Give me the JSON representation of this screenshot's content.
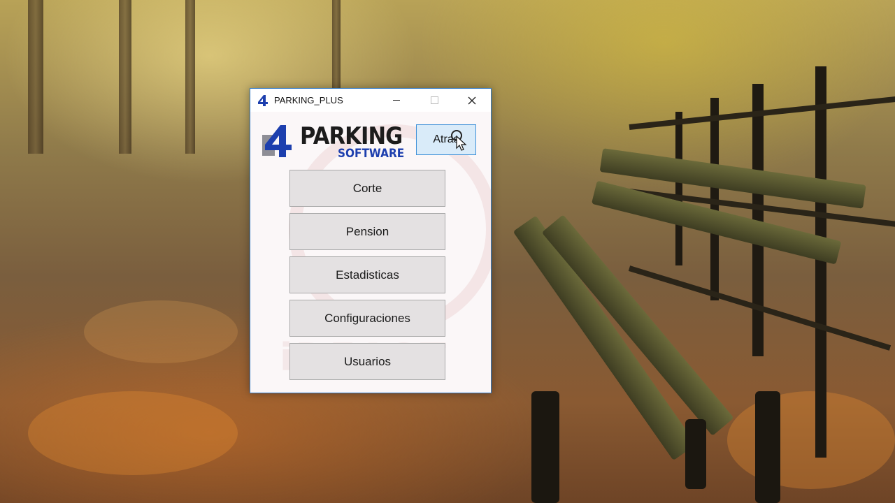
{
  "window": {
    "title": "PARKING_PLUS",
    "accent_color": "#2f78c4"
  },
  "logo": {
    "mark": "4",
    "word_top": "PARKING",
    "word_bottom": "SOFTWARE",
    "brand_color": "#1d3fae"
  },
  "toolbar": {
    "back_label": "Atras"
  },
  "menu": {
    "items": [
      {
        "label": "Corte"
      },
      {
        "label": "Pension"
      },
      {
        "label": "Estadisticas"
      },
      {
        "label": "Configuraciones"
      },
      {
        "label": "Usuarios"
      }
    ]
  },
  "icons": {
    "app": "parking-logo-icon",
    "minimize": "minimize-icon",
    "maximize": "maximize-icon",
    "close": "close-icon",
    "cursor": "busy-cursor-icon"
  }
}
